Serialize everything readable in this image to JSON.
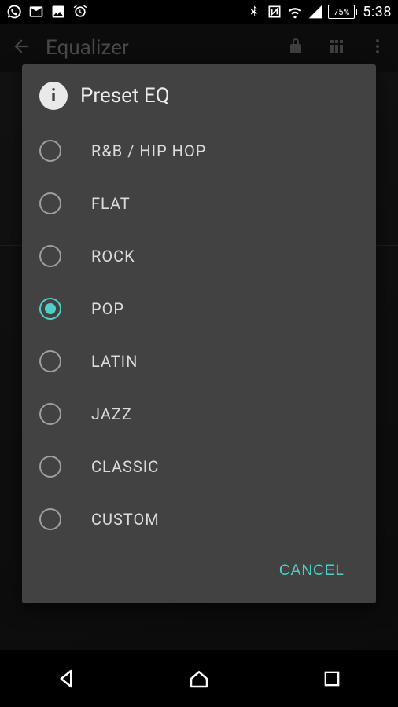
{
  "status": {
    "battery_pct": "75%",
    "clock": "5:38"
  },
  "app": {
    "back_screen_title": "Equalizer"
  },
  "dialog": {
    "title": "Preset EQ",
    "selected_index": 3,
    "options": [
      {
        "label": "R&B / HIP HOP"
      },
      {
        "label": "FLAT"
      },
      {
        "label": "ROCK"
      },
      {
        "label": "POP"
      },
      {
        "label": "LATIN"
      },
      {
        "label": "JAZZ"
      },
      {
        "label": "CLASSIC"
      },
      {
        "label": "CUSTOM"
      }
    ],
    "cancel_label": "CANCEL"
  }
}
